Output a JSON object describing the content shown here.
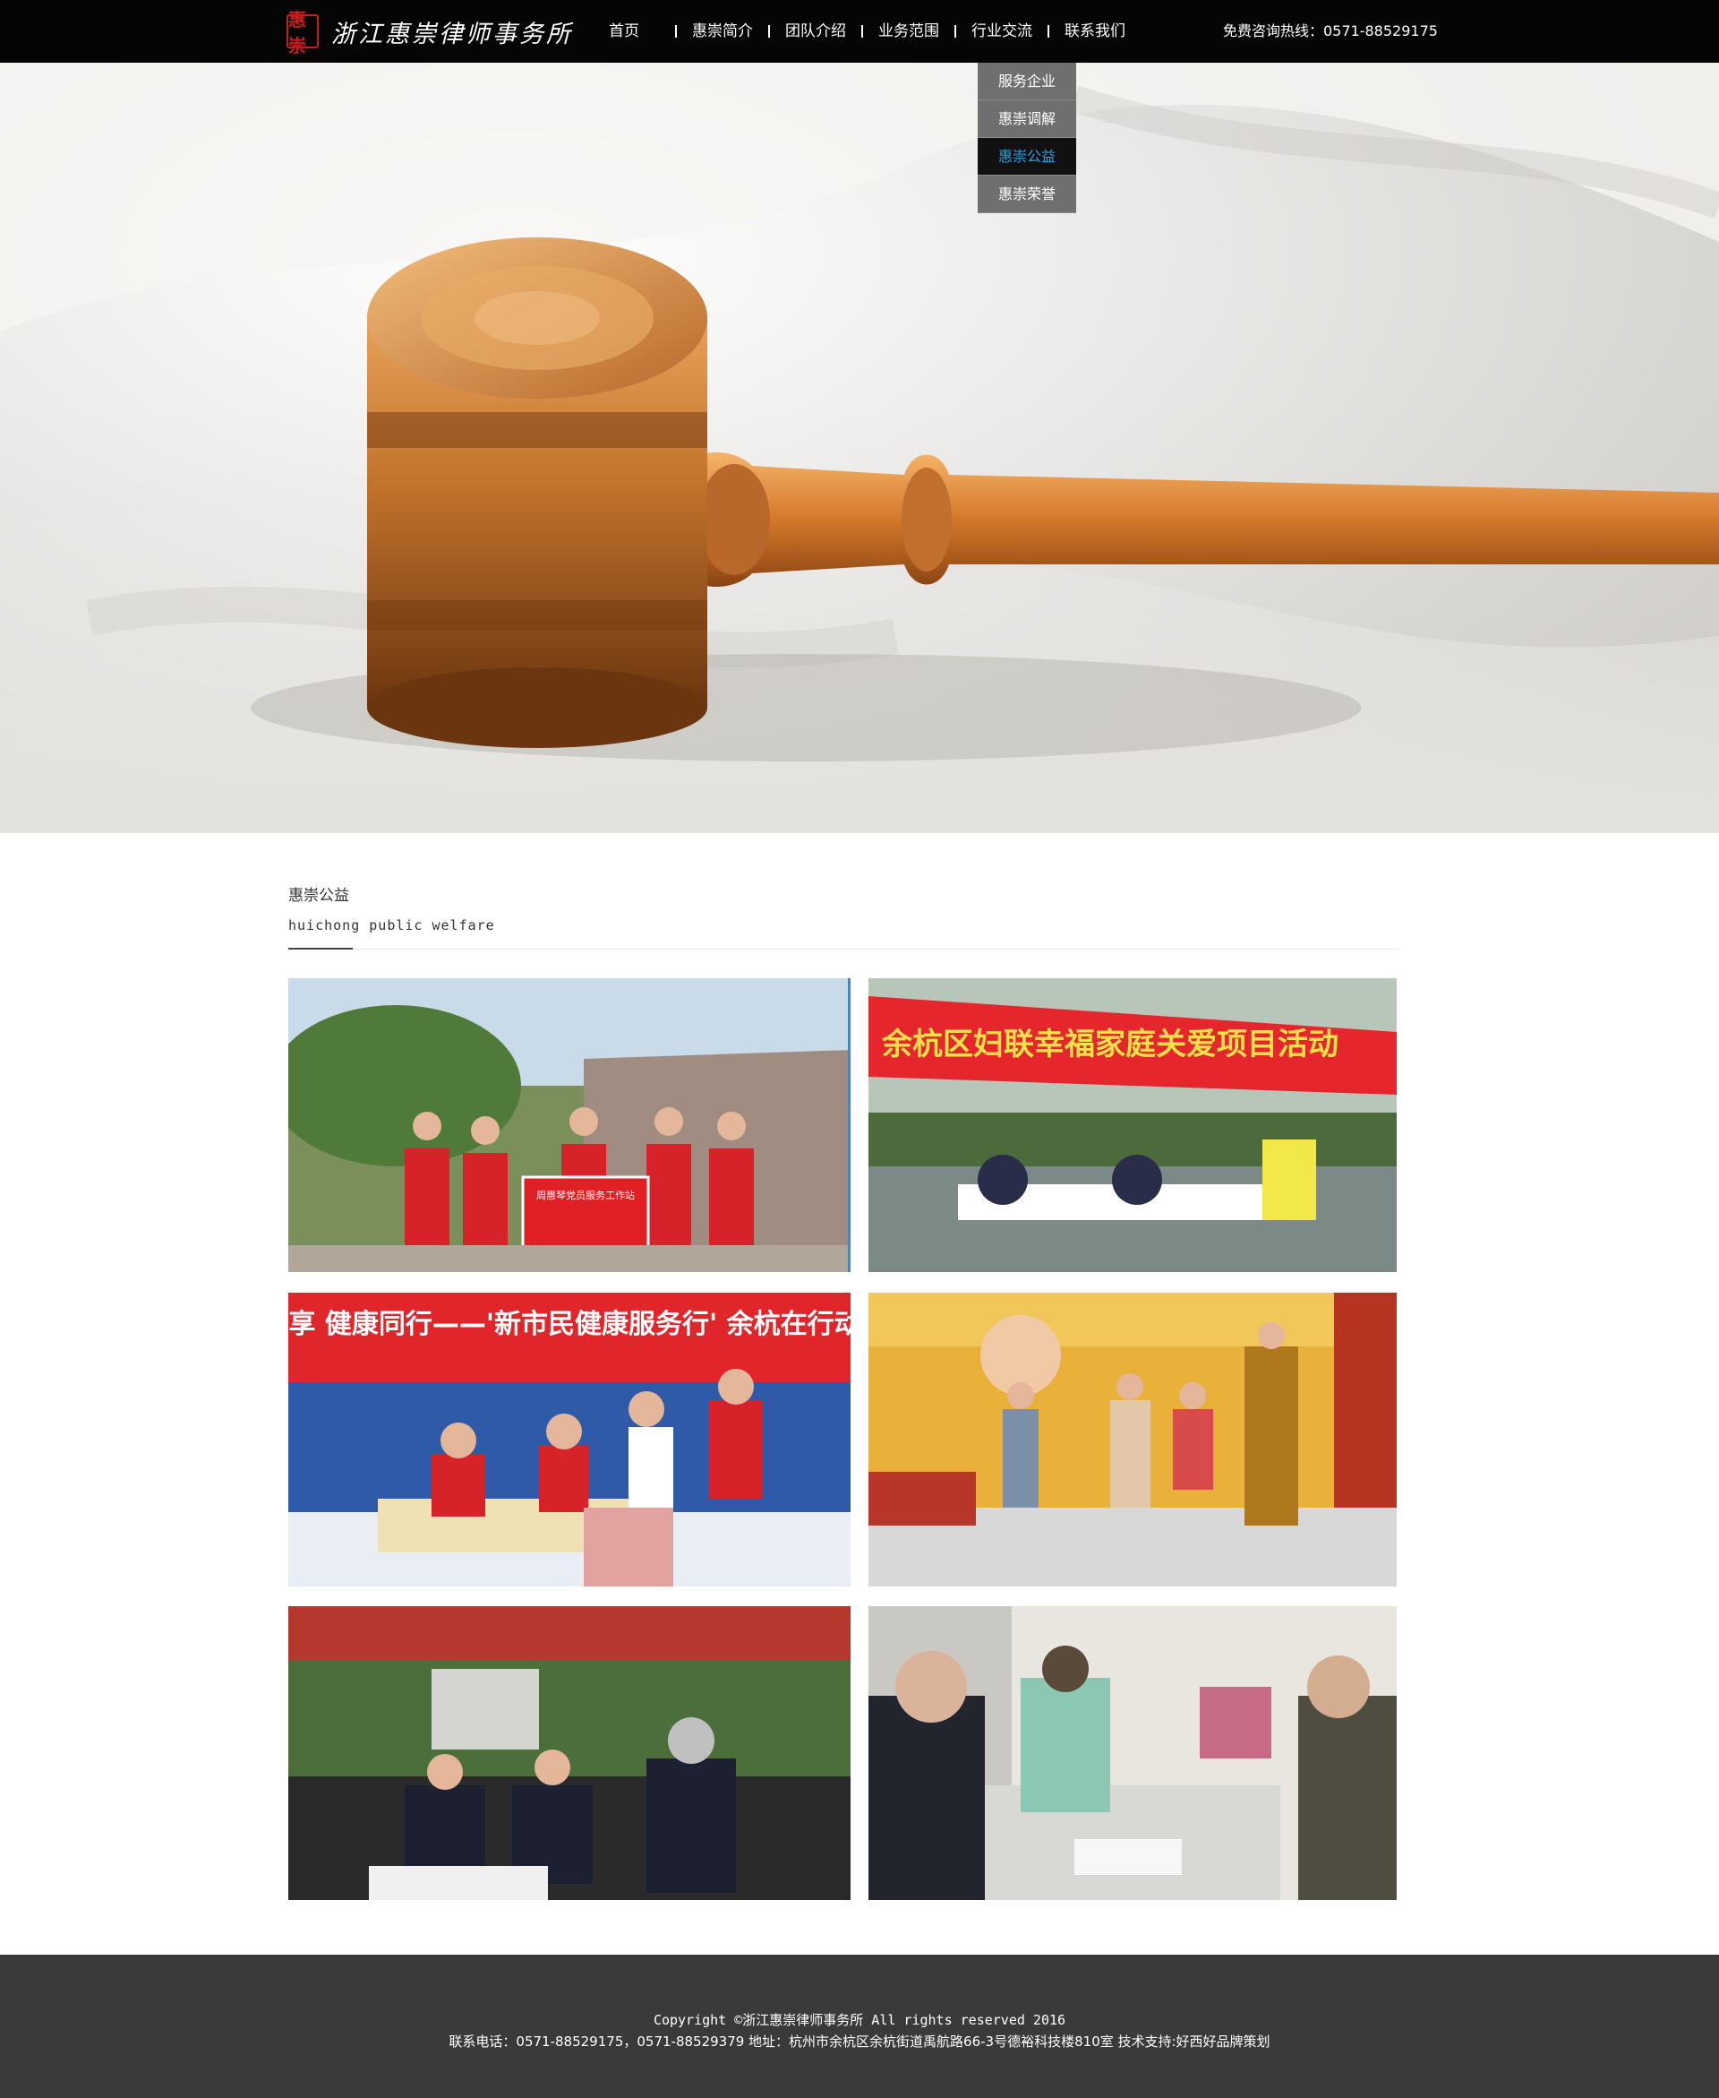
{
  "brand": {
    "seal_text": "惠崇",
    "name": "浙江惠崇律师事务所"
  },
  "nav": {
    "items": [
      {
        "label": "首页"
      },
      {
        "label": "惠崇简介"
      },
      {
        "label": "团队介绍"
      },
      {
        "label": "业务范围"
      },
      {
        "label": "行业交流"
      },
      {
        "label": "联系我们"
      }
    ],
    "hotline": "免费咨询热线：0571-88529175"
  },
  "dropdown": {
    "items": [
      {
        "label": "服务企业"
      },
      {
        "label": "惠崇调解"
      },
      {
        "label": "惠崇公益"
      },
      {
        "label": "惠崇荣誉"
      }
    ],
    "active": "惠崇公益"
  },
  "section": {
    "title": "惠崇公益",
    "subtitle": "huichong public welfare"
  },
  "gallery": {
    "photos": [
      {
        "banner": "周惠琴党员服务工作站",
        "accent": "#d9232a"
      },
      {
        "banner": "余杭区妇联幸福家庭关爱项目活动",
        "accent": "#e8262d"
      },
      {
        "banner": "健共享 健康同行——'新市民健康服务行' 余杭在行动",
        "accent": "#e0262b"
      },
      {
        "banner": "",
        "accent": "#d58a1f"
      },
      {
        "banner": "",
        "accent": "#b5382f"
      },
      {
        "banner": "",
        "accent": "#c66b86"
      }
    ]
  },
  "footer": {
    "copyright": "Copyright ©浙江惠崇律师事务所 All rights reserved 2016",
    "contact": "联系电话：0571-88529175，0571-88529379 地址：杭州市余杭区余杭街道禹航路66-3号德裕科技楼810室 技术支持:好西好品牌策划"
  }
}
